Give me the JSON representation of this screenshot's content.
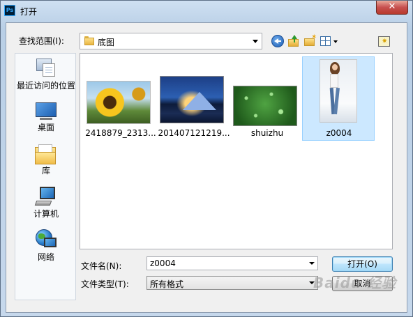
{
  "window": {
    "title": "打开",
    "app_icon": "Ps",
    "close_symbol": "✕"
  },
  "toolbar": {
    "lookin_label": "查找范围(I):",
    "lookin_value": "底图",
    "buttons": [
      "back-icon",
      "up-folder-icon",
      "new-folder-icon",
      "views-menu-icon",
      "image-preview-icon"
    ]
  },
  "places": [
    {
      "label": "最近访问的位置",
      "icon": "recent-places-icon"
    },
    {
      "label": "桌面",
      "icon": "desktop-icon"
    },
    {
      "label": "库",
      "icon": "libraries-icon"
    },
    {
      "label": "计算机",
      "icon": "computer-icon"
    },
    {
      "label": "网络",
      "icon": "network-icon"
    }
  ],
  "files": [
    {
      "name": "2418879_2313...",
      "selected": false
    },
    {
      "name": "201407121219...",
      "selected": false
    },
    {
      "name": "shuizhu",
      "selected": false
    },
    {
      "name": "z0004",
      "selected": true
    }
  ],
  "bottom": {
    "filename_label": "文件名(N):",
    "filename_value": "z0004",
    "filetype_label": "文件类型(T):",
    "filetype_value": "所有格式",
    "open_label": "打开(O)",
    "cancel_label": "取消"
  },
  "watermark": "Baidu 经验",
  "colors": {
    "selection": "#cce8ff",
    "title_close": "#c75050"
  }
}
